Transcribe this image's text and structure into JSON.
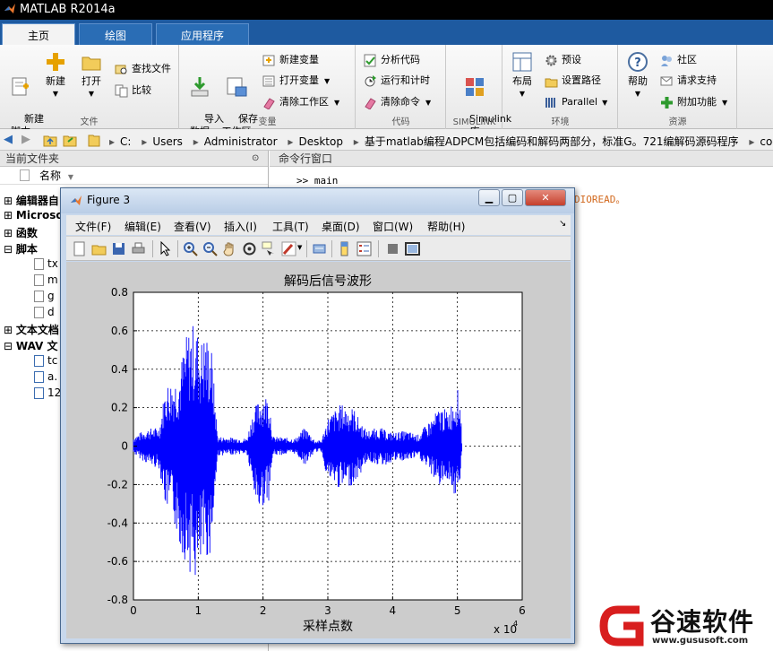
{
  "window": {
    "title": "MATLAB R2014a"
  },
  "tabs": [
    {
      "label": "主页"
    },
    {
      "label": "绘图"
    },
    {
      "label": "应用程序"
    }
  ],
  "ribbon": {
    "file_group": {
      "label": "文件",
      "new_script": "新建\n脚本",
      "new": "新建",
      "open": "打开",
      "find_files": "查找文件",
      "compare": "比较"
    },
    "variable_group": {
      "label": "变量",
      "import_data": "导入\n数据",
      "save_workspace": "保存\n工作区",
      "new_variable": "新建变量",
      "open_variable": "打开变量",
      "clear_workspace": "清除工作区"
    },
    "code_group": {
      "label": "代码",
      "analyze_code": "分析代码",
      "run_and_time": "运行和计时",
      "clear_commands": "清除命令"
    },
    "simulink_group": {
      "label": "SIMULINK",
      "library": "Simulink\n库"
    },
    "environment_group": {
      "label": "环境",
      "layout": "布局",
      "preferences": "预设",
      "set_path": "设置路径",
      "parallel": "Parallel"
    },
    "resources_group": {
      "label": "资源",
      "help": "帮助",
      "community": "社区",
      "request_support": "请求支持",
      "add_ons": "附加功能"
    }
  },
  "breadcrumbs": [
    "C:",
    "Users",
    "Administrator",
    "Desktop",
    "基于matlab编程ADPCM包括编码和解码两部分，标准G。721编解码源码程序",
    "code"
  ],
  "left_panel": {
    "title": "当前文件夹",
    "name_column": "名称",
    "rows": [
      {
        "label": "编辑器自",
        "kind": "group"
      },
      {
        "label": "Microso",
        "kind": "group"
      },
      {
        "label": "函数",
        "kind": "group"
      },
      {
        "label": "脚本",
        "kind": "group"
      },
      {
        "label": "tx",
        "kind": "file"
      },
      {
        "label": "m",
        "kind": "file"
      },
      {
        "label": "g",
        "kind": "file"
      },
      {
        "label": "d",
        "kind": "file"
      },
      {
        "label": "文本文档",
        "kind": "group"
      },
      {
        "label": "WAV 文",
        "kind": "group"
      },
      {
        "label": "tc",
        "kind": "file"
      },
      {
        "label": "a.",
        "kind": "file"
      },
      {
        "label": "12",
        "kind": "file"
      }
    ]
  },
  "command_window": {
    "title": "命令行窗口",
    "prompt": ">>",
    "command": "main",
    "warning_fragment": "DIOREAD。"
  },
  "figure": {
    "title": "Figure 3",
    "menus": [
      "文件(F)",
      "编辑(E)",
      "查看(V)",
      "插入(I)",
      "工具(T)",
      "桌面(D)",
      "窗口(W)",
      "帮助(H)"
    ],
    "toolbar_icons": [
      "new-figure-icon",
      "open-icon",
      "save-icon",
      "print-icon",
      "pointer-icon",
      "zoom-in-icon",
      "zoom-out-icon",
      "pan-icon",
      "rotate-icon",
      "data-cursor-icon",
      "brush-icon",
      "link-icon",
      "colorbar-icon",
      "legend-icon",
      "hide-plot-tools-icon",
      "show-plot-tools-icon"
    ]
  },
  "chart_data": {
    "type": "line",
    "title": "解码后信号波形",
    "xlabel": "采样点数",
    "ylabel": "",
    "x_exponent_label": "x 10",
    "x_exponent": "4",
    "xlim": [
      0,
      60000
    ],
    "ylim": [
      -0.8,
      0.8
    ],
    "xticks": [
      0,
      1,
      2,
      3,
      4,
      5,
      6
    ],
    "yticks": [
      -0.8,
      -0.6,
      -0.4,
      -0.2,
      0,
      0.2,
      0.4,
      0.6,
      0.8
    ],
    "grid": true,
    "grid_style": "dotted",
    "series": [
      {
        "color": "#0000ff",
        "envelope": [
          [
            0,
            0.05,
            -0.04
          ],
          [
            2000,
            0.09,
            -0.09
          ],
          [
            4000,
            0.1,
            -0.12
          ],
          [
            5000,
            0.33,
            -0.33
          ],
          [
            6000,
            0.35,
            -0.36
          ],
          [
            7000,
            0.38,
            -0.52
          ],
          [
            8000,
            0.56,
            -0.6
          ],
          [
            9000,
            0.65,
            -0.68
          ],
          [
            10000,
            0.6,
            -0.74
          ],
          [
            10500,
            0.56,
            -0.65
          ],
          [
            11000,
            0.6,
            -0.6
          ],
          [
            12000,
            0.54,
            -0.56
          ],
          [
            13000,
            0.05,
            -0.05
          ],
          [
            17500,
            0.04,
            -0.04
          ],
          [
            18500,
            0.19,
            -0.25
          ],
          [
            19500,
            0.25,
            -0.35
          ],
          [
            20000,
            0.28,
            -0.31
          ],
          [
            21000,
            0.26,
            -0.28
          ],
          [
            21500,
            0.05,
            -0.05
          ],
          [
            25000,
            0.04,
            -0.04
          ],
          [
            26500,
            0.1,
            -0.1
          ],
          [
            28000,
            0.03,
            -0.03
          ],
          [
            29000,
            0.03,
            -0.03
          ],
          [
            30000,
            0.15,
            -0.18
          ],
          [
            32000,
            0.22,
            -0.23
          ],
          [
            34000,
            0.2,
            -0.2
          ],
          [
            35000,
            0.13,
            -0.15
          ],
          [
            36000,
            0.08,
            -0.08
          ],
          [
            38000,
            0.1,
            -0.1
          ],
          [
            39000,
            0.08,
            -0.1
          ],
          [
            40000,
            0.07,
            -0.08
          ],
          [
            42000,
            0.08,
            -0.08
          ],
          [
            44000,
            0.06,
            -0.06
          ],
          [
            47500,
            0.21,
            -0.22
          ],
          [
            48500,
            0.18,
            -0.17
          ],
          [
            49500,
            0.26,
            -0.26
          ],
          [
            50000,
            0.3,
            -0.28
          ],
          [
            50500,
            0.24,
            -0.2
          ],
          [
            50700,
            0.0,
            0.0
          ]
        ]
      }
    ]
  },
  "watermark": {
    "name": "谷速软件",
    "url": "www.gususoft.com"
  }
}
